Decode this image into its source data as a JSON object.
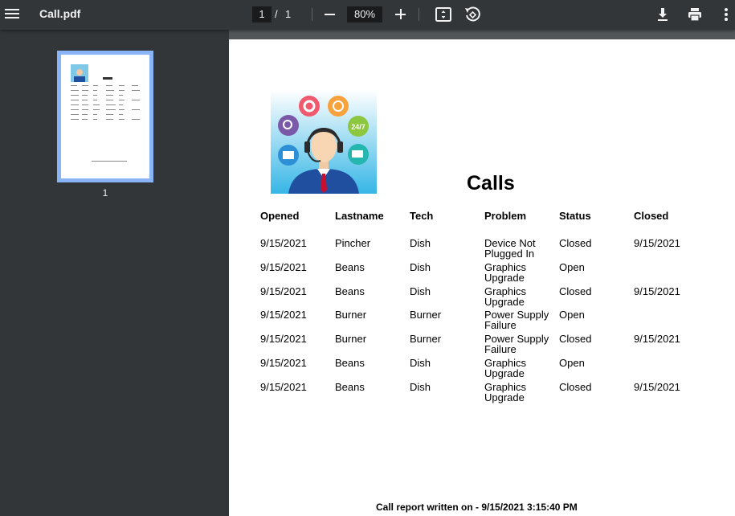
{
  "app": {
    "file_title": "Call.pdf",
    "page_current": "1",
    "page_separator": "/",
    "page_total": "1",
    "zoom": "80%"
  },
  "sidebar": {
    "thumbnail_label": "1"
  },
  "document": {
    "title": "Calls",
    "columns": [
      "Opened",
      "Lastname",
      "Tech",
      "Problem",
      "Status",
      "Closed"
    ],
    "rows": [
      {
        "opened": "9/15/2021",
        "lastname": "Pincher",
        "tech": "Dish",
        "problem_1": "Device Not",
        "problem_2": "Plugged In",
        "status": "Closed",
        "closed": "9/15/2021"
      },
      {
        "opened": "9/15/2021",
        "lastname": "Beans",
        "tech": "Dish",
        "problem_1": "Graphics",
        "problem_2": "Upgrade",
        "status": "Open",
        "closed": ""
      },
      {
        "opened": "9/15/2021",
        "lastname": "Beans",
        "tech": "Dish",
        "problem_1": "Graphics",
        "problem_2": "Upgrade",
        "status": "Closed",
        "closed": "9/15/2021"
      },
      {
        "opened": "9/15/2021",
        "lastname": "Burner",
        "tech": "Burner",
        "problem_1": "Power Supply",
        "problem_2": "Failure",
        "status": "Open",
        "closed": ""
      },
      {
        "opened": "9/15/2021",
        "lastname": "Burner",
        "tech": "Burner",
        "problem_1": "Power Supply",
        "problem_2": "Failure",
        "status": "Closed",
        "closed": "9/15/2021"
      },
      {
        "opened": "9/15/2021",
        "lastname": "Beans",
        "tech": "Dish",
        "problem_1": "Graphics",
        "problem_2": "Upgrade",
        "status": "Open",
        "closed": ""
      },
      {
        "opened": "9/15/2021",
        "lastname": "Beans",
        "tech": "Dish",
        "problem_1": "Graphics",
        "problem_2": "Upgrade",
        "status": "Closed",
        "closed": "9/15/2021"
      }
    ],
    "footer": "Call report written on - 9/15/2021 3:15:40 PM",
    "logo_badge_text": "24/7"
  },
  "icons": [
    "menu-icon",
    "minus-icon",
    "plus-icon",
    "fit-page-icon",
    "rotate-icon",
    "download-icon",
    "print-icon",
    "more-vert-icon"
  ],
  "colors": {
    "toolbar_bg": "#323639",
    "viewer_bg": "#525659",
    "thumb_border": "#8ab4f8"
  }
}
